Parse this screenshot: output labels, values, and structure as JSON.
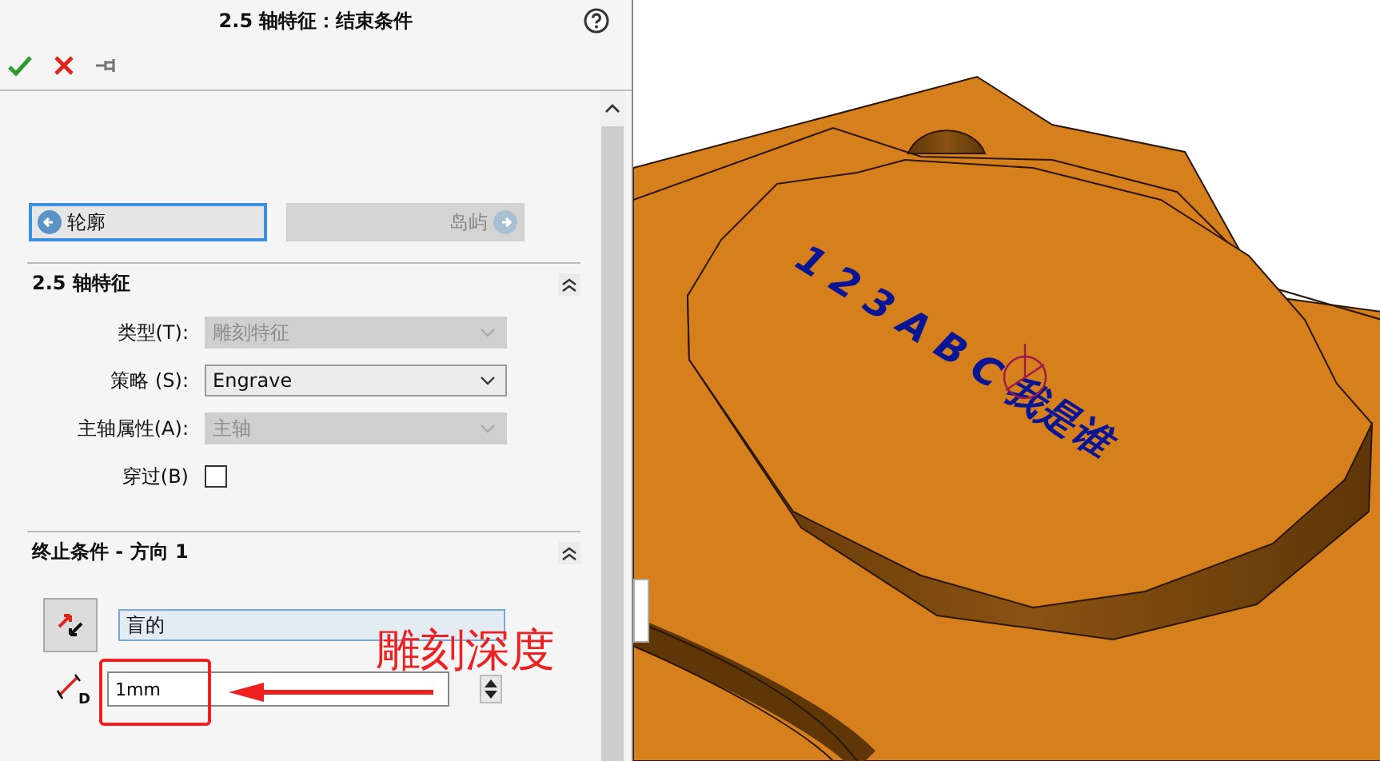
{
  "panel": {
    "title": "2.5 轴特征：结束条件"
  },
  "nav_buttons": [
    {
      "label": "轮廓",
      "kind": "back",
      "disabled": false
    },
    {
      "label": "岛屿",
      "kind": "next",
      "disabled": true
    }
  ],
  "feature_section": {
    "title": "2.5 轴特征",
    "expanded": true,
    "fields": [
      {
        "kind": "select",
        "label": "类型(T):",
        "value": "雕刻特征",
        "disabled": true
      },
      {
        "kind": "select",
        "label": "策略 (S):",
        "value": "Engrave",
        "disabled": false
      },
      {
        "kind": "select",
        "label": "主轴属性(A):",
        "value": "主轴",
        "disabled": true
      },
      {
        "kind": "checkbox",
        "label": "穿过(B)",
        "checked": false
      }
    ]
  },
  "end_section": {
    "title": "终止条件 - 方向 1",
    "expanded": true,
    "condition": "盲的",
    "depth_symbol": "D",
    "depth": "1mm"
  },
  "annotation": {
    "text": "雕刻深度"
  },
  "viewport": {
    "engraving": "1 2 3 A B C 我是谁"
  }
}
